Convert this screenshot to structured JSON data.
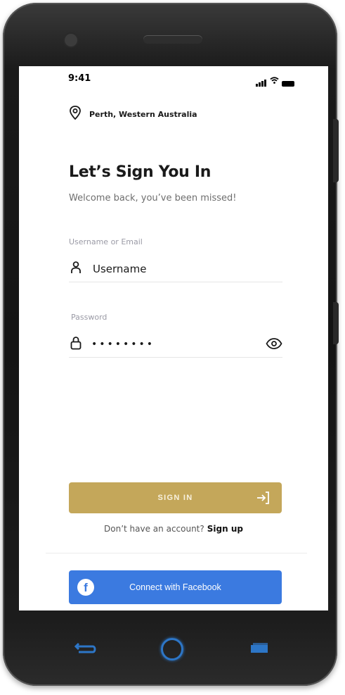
{
  "status_bar": {
    "time": "9:41"
  },
  "location": {
    "text": "Perth, Western Australia"
  },
  "header": {
    "title": "Let’s Sign You In",
    "subtitle": "Welcome back, you’ve been missed!"
  },
  "form": {
    "username": {
      "label": "Username or Email",
      "value": "Username"
    },
    "password": {
      "label": "Password",
      "value": "••••••••"
    }
  },
  "actions": {
    "sign_in_label": "SIGN IN",
    "no_account_text": "Don’t have an account?",
    "sign_up_label": "Sign up",
    "facebook_label": "Connect with Facebook"
  },
  "colors": {
    "sign_in_button": "#c4a75a",
    "facebook_button": "#3b7ae0",
    "nav_accent": "#2d76c7"
  },
  "icons": [
    "location-pin-icon",
    "user-icon",
    "lock-icon",
    "eye-icon",
    "arrow-login-icon",
    "facebook-icon",
    "signal-icon",
    "wifi-icon",
    "battery-icon",
    "back-icon",
    "home-icon",
    "recent-apps-icon"
  ]
}
